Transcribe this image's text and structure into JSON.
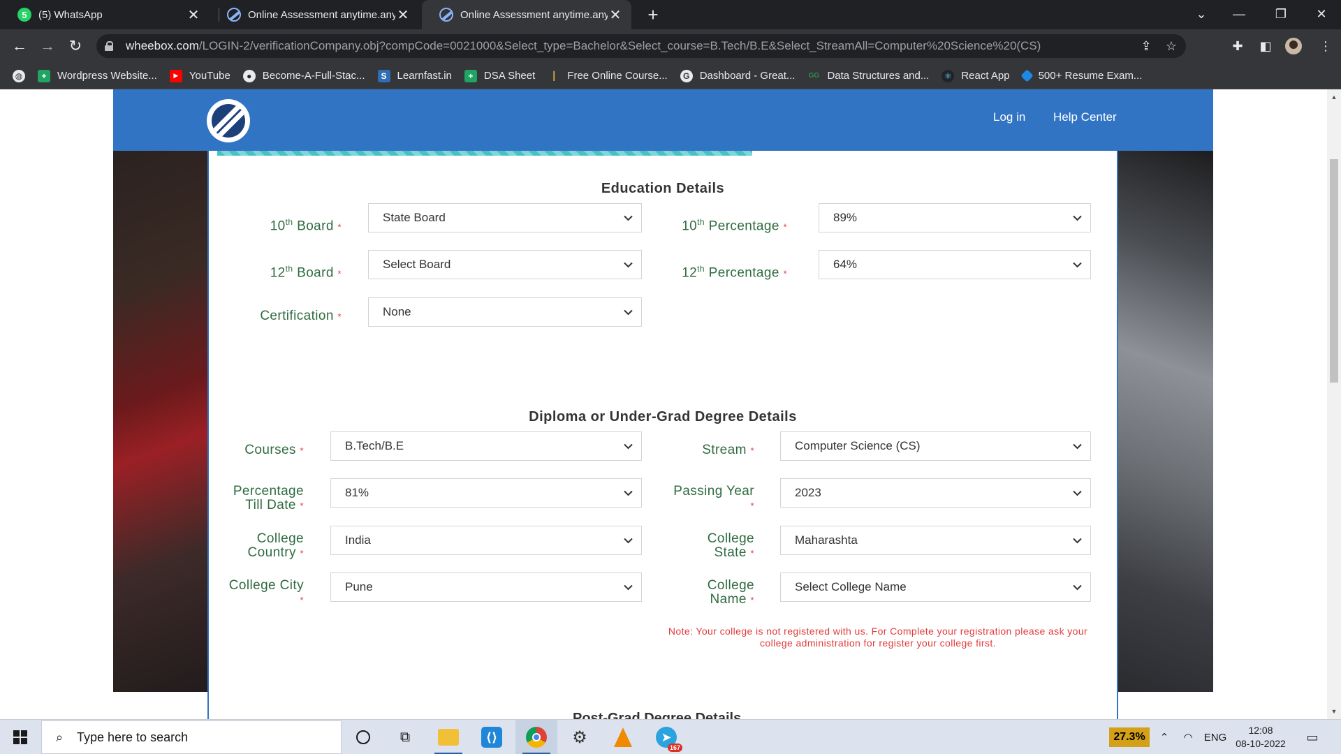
{
  "browser": {
    "tabs": [
      {
        "title": "(5) WhatsApp",
        "badge": "5"
      },
      {
        "title": "Online Assessment anytime.anyw"
      },
      {
        "title": "Online Assessment anytime.anyw"
      }
    ],
    "url_host": "wheebox.com",
    "url_path": "/LOGIN-2/verificationCompany.obj?compCode=0021000&Select_type=Bachelor&Select_course=B.Tech/B.E&Select_StreamAll=Computer%20Science%20(CS)",
    "bookmarks": [
      {
        "label": "Wordpress Website...",
        "icon": "plus-icon",
        "color": "#1fa463"
      },
      {
        "label": "YouTube",
        "icon": "youtube-icon",
        "color": "#ff0000"
      },
      {
        "label": "Become-A-Full-Stac...",
        "icon": "github-icon",
        "color": "#24292e"
      },
      {
        "label": "Learnfast.in",
        "icon": "learnfast-icon",
        "color": "#2f6db5"
      },
      {
        "label": "DSA Sheet",
        "icon": "plus-icon",
        "color": "#1fa463"
      },
      {
        "label": "Free Online Course...",
        "icon": "bar-icon",
        "color": "#caa53d"
      },
      {
        "label": "Dashboard - Great...",
        "icon": "g-icon",
        "color": "#5f6368"
      },
      {
        "label": "Data Structures and...",
        "icon": "gfg-icon",
        "color": "#2f8d46"
      },
      {
        "label": "React App",
        "icon": "react-icon",
        "color": "#61dafb"
      },
      {
        "label": "500+ Resume Exam...",
        "icon": "resume-icon",
        "color": "#1e88e5"
      }
    ]
  },
  "site": {
    "nav": {
      "login": "Log in",
      "help": "Help Center"
    }
  },
  "education": {
    "title": "Education Details",
    "board10_label": "Board",
    "board10_value": "State Board",
    "pct10_label": "Percentage",
    "pct10_value": "89%",
    "board12_label": "Board",
    "board12_value": "Select Board",
    "pct12_label": "Percentage",
    "pct12_value": "64%",
    "cert_label": "Certification",
    "cert_value": "None",
    "num10": "10",
    "num12": "12",
    "sup": "th"
  },
  "diploma": {
    "title": "Diploma or Under-Grad Degree Details",
    "courses_label": "Courses",
    "courses_value": "B.Tech/B.E",
    "stream_label": "Stream",
    "stream_value": "Computer Science (CS)",
    "pct_label_1": "Percentage",
    "pct_label_2": "Till Date",
    "pct_value": "81%",
    "year_label": "Passing Year",
    "year_value": "2023",
    "country_label_1": "College",
    "country_label_2": "Country",
    "country_value": "India",
    "state_label_1": "College",
    "state_label_2": "State",
    "state_value": "Maharashta",
    "city_label": "College City",
    "city_value": "Pune",
    "cname_label_1": "College",
    "cname_label_2": "Name",
    "cname_value": "Select College Name",
    "note": "Note: Your college is not registered with us. For Complete your registration please ask your college administration for register your college first."
  },
  "postgrad": {
    "title": "Post-Grad Degree Details"
  },
  "required_mark": "*",
  "taskbar": {
    "search_placeholder": "Type here to search",
    "cpu": "27.3%",
    "lang": "ENG",
    "time": "12:08",
    "date": "08-10-2022",
    "telegram_badge": "167"
  }
}
